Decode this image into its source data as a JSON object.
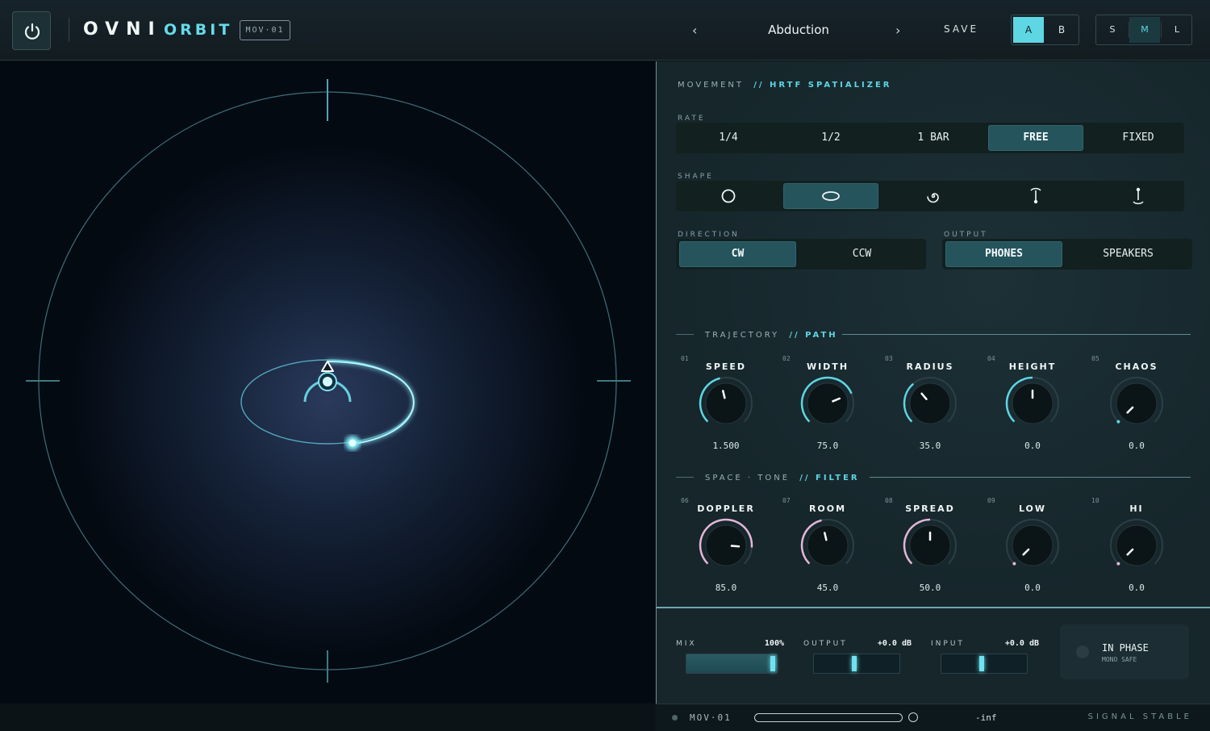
{
  "header": {
    "brand": "OVNI",
    "product": "ORBIT",
    "badge": "MOV·01",
    "preset_prev": "‹",
    "preset_name": "Abduction",
    "preset_next": "›",
    "save": "SAVE",
    "ab": [
      {
        "label": "A",
        "active": true
      },
      {
        "label": "B",
        "active": false
      }
    ],
    "sizes": [
      {
        "label": "S",
        "active": false
      },
      {
        "label": "M",
        "active": true
      },
      {
        "label": "L",
        "active": false
      }
    ]
  },
  "movement": {
    "title": "MOVEMENT",
    "title_accent": "// HRTF SPATIALIZER",
    "rate_label": "RATE",
    "rate_options": [
      "1/4",
      "1/2",
      "1 BAR",
      "FREE",
      "FIXED"
    ],
    "rate_selected": "FREE",
    "shape_label": "SHAPE",
    "shape_options": [
      "circle-icon",
      "ellipse-icon",
      "spiral-icon",
      "pendulum-top-icon",
      "pendulum-bottom-icon"
    ],
    "shape_selected": "ellipse-icon",
    "direction_label": "DIRECTION",
    "direction_options": [
      "CW",
      "CCW"
    ],
    "direction_selected": "CW",
    "output_label": "OUTPUT",
    "output_options": [
      "PHONES",
      "SPEAKERS"
    ],
    "output_selected": "PHONES"
  },
  "trajectory": {
    "title": "TRAJECTORY",
    "title_accent": "// PATH",
    "knobs": [
      {
        "num": "01",
        "label": "SPEED",
        "value": "1.500",
        "level": 0.45
      },
      {
        "num": "02",
        "label": "WIDTH",
        "value": "75.0",
        "level": 0.75
      },
      {
        "num": "03",
        "label": "RADIUS",
        "value": "35.0",
        "level": 0.35
      },
      {
        "num": "04",
        "label": "HEIGHT",
        "value": "0.0",
        "level": 0.5
      },
      {
        "num": "05",
        "label": "CHAOS",
        "value": "0.0",
        "level": 0.0
      }
    ]
  },
  "space_tone": {
    "title": "SPACE · TONE",
    "title_accent": "// FILTER",
    "knobs": [
      {
        "num": "06",
        "label": "DOPPLER",
        "value": "85.0",
        "level": 0.85
      },
      {
        "num": "07",
        "label": "ROOM",
        "value": "45.0",
        "level": 0.45
      },
      {
        "num": "08",
        "label": "SPREAD",
        "value": "50.0",
        "level": 0.5
      },
      {
        "num": "09",
        "label": "LOW",
        "value": "0.0",
        "level": 0.0
      },
      {
        "num": "10",
        "label": "HI",
        "value": "0.0",
        "level": 0.0
      }
    ]
  },
  "mix": {
    "mix_label": "MIX",
    "mix_value": "100%",
    "mix_level": 1.0,
    "output_label": "OUTPUT",
    "output_value": "+0.0 dB",
    "output_level": 0.5,
    "input_label": "INPUT",
    "input_value": "+0.0 dB",
    "input_level": 0.5,
    "phase_title": "IN PHASE",
    "phase_sub": "MONO SAFE"
  },
  "status": {
    "id": "MOV·01",
    "level": "-inf",
    "signal": "SIGNAL STABLE"
  },
  "colors": {
    "accent": "#5ed6e3",
    "accent_pink": "#e4b6d8",
    "panel_bg": "#16262b"
  }
}
